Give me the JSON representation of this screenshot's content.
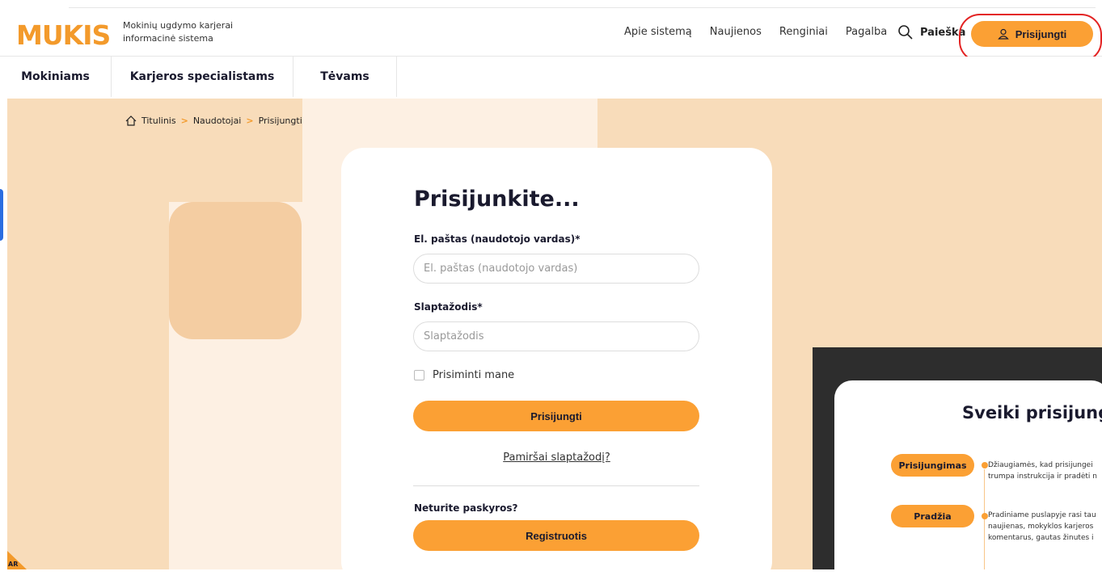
{
  "header": {
    "logo_text": "MUKIS",
    "tagline": "Mokinių ugdymo karjerai informacinė sistema",
    "nav": [
      "Apie sistemą",
      "Naujienos",
      "Renginiai",
      "Pagalba"
    ],
    "search_label": "Paieška",
    "login_label": "Prisijungti"
  },
  "subnav": [
    "Mokiniams",
    "Karjeros specialistams",
    "Tėvams"
  ],
  "breadcrumb": [
    "Titulinis",
    "Naudotojai",
    "Prisijungti"
  ],
  "form": {
    "title": "Prisijunkite...",
    "email_label": "El. paštas (naudotojo vardas)*",
    "email_placeholder": "El. paštas (naudotojo vardas)",
    "password_label": "Slaptažodis*",
    "password_placeholder": "Slaptažodis",
    "remember_label": "Prisiminti mane",
    "submit_label": "Prisijungti",
    "forgot_label": "Pamiršai slaptažodį?",
    "no_account_label": "Neturite paskyros?",
    "register_label": "Registruotis"
  },
  "corner_badge": "AR",
  "popup": {
    "title": "Sveiki prisijungę",
    "steps": [
      {
        "label": "Prisijungimas",
        "text1": "Džiaugiamės, kad prisijungei",
        "text2": "trumpa instrukcija ir pradėti n"
      },
      {
        "label": "Pradžia",
        "text1": "Pradiniame puslapyje rasi tau",
        "text2": "naujienas, mokyklos karjeros",
        "text3": "komentarus, gautas žinutes i"
      }
    ]
  },
  "colors": {
    "accent": "#fba034",
    "highlight": "#e32222",
    "bg_peach": "#f8dcba"
  }
}
